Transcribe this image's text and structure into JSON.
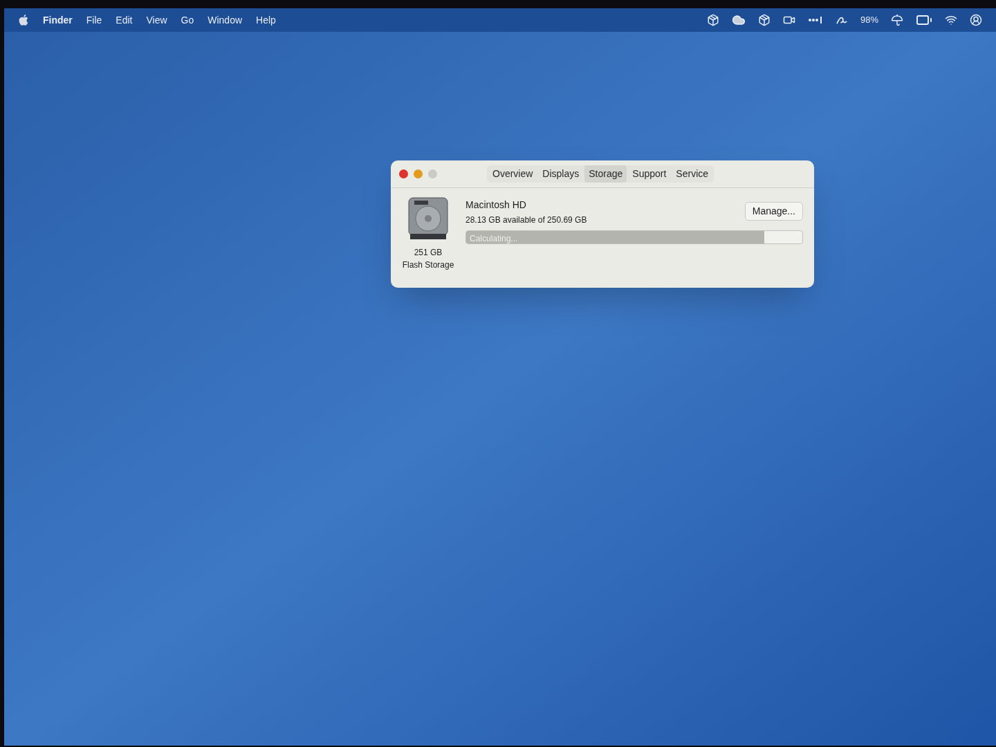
{
  "menu_bar": {
    "items": [
      {
        "label": "Finder",
        "bold": true
      },
      {
        "label": "File",
        "bold": false
      },
      {
        "label": "Edit",
        "bold": false
      },
      {
        "label": "View",
        "bold": false
      },
      {
        "label": "Go",
        "bold": false
      },
      {
        "label": "Window",
        "bold": false
      },
      {
        "label": "Help",
        "bold": false
      }
    ],
    "battery_percent": "98%"
  },
  "window": {
    "tabs": [
      {
        "label": "Overview",
        "selected": false
      },
      {
        "label": "Displays",
        "selected": false
      },
      {
        "label": "Storage",
        "selected": true
      },
      {
        "label": "Support",
        "selected": false
      },
      {
        "label": "Service",
        "selected": false
      }
    ],
    "disk": {
      "size": "251 GB",
      "type": "Flash Storage",
      "name": "Macintosh HD",
      "available": "28.13 GB available of 250.69 GB",
      "bar_label": "Calculating...",
      "level": 0.886
    },
    "manage_button": "Manage..."
  }
}
